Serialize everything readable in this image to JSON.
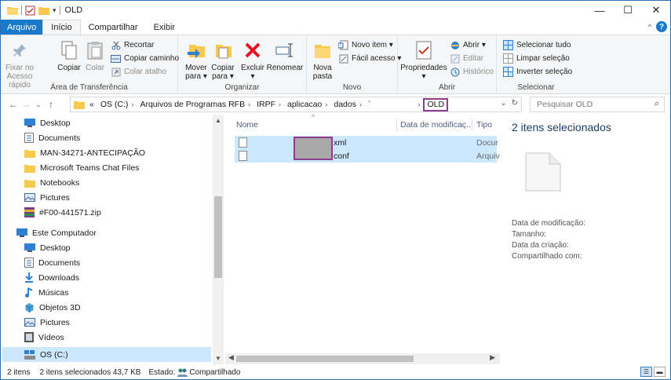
{
  "window": {
    "title": "OLD"
  },
  "tabs": {
    "file": "Arquivo",
    "home": "Início",
    "share": "Compartilhar",
    "view": "Exibir"
  },
  "ribbon": {
    "clipboard": {
      "label": "Área de Transferência",
      "pin": "Fixar no Acesso rápido",
      "copy": "Copiar",
      "paste": "Colar",
      "cut": "Recortar",
      "copy_path": "Copiar caminho",
      "paste_shortcut": "Colar atalho"
    },
    "organize": {
      "label": "Organizar",
      "move_to": "Mover para ▾",
      "copy_to": "Copiar para ▾",
      "delete": "Excluir ▾",
      "rename": "Renomear"
    },
    "new": {
      "label": "Novo",
      "new_folder": "Nova pasta",
      "new_item": "Novo item ▾",
      "easy_access": "Fácil acesso ▾"
    },
    "open": {
      "label": "Abrir",
      "properties": "Propriedades ▾",
      "open": "Abrir ▾",
      "edit": "Editar",
      "history": "Histórico"
    },
    "select": {
      "label": "Selecionar",
      "select_all": "Selecionar tudo",
      "select_none": "Limpar seleção",
      "invert": "Inverter seleção"
    }
  },
  "address": {
    "breadcrumbs": [
      "«",
      "OS (C:)",
      "Arquivos de Programas RFB",
      "IRPF",
      "aplicacao",
      "dados",
      "`",
      "OLD"
    ],
    "search_placeholder": "Pesquisar OLD"
  },
  "nav": {
    "items": [
      {
        "label": "Desktop",
        "icon": "desktop-icon"
      },
      {
        "label": "Documents",
        "icon": "documents-icon"
      },
      {
        "label": "MAN-34271-ANTECIPAÇÃO",
        "icon": "folder-icon"
      },
      {
        "label": "Microsoft Teams Chat Files",
        "icon": "folder-icon"
      },
      {
        "label": "Notebooks",
        "icon": "folder-icon"
      },
      {
        "label": "Pictures",
        "icon": "pictures-icon"
      },
      {
        "label": "#F00-441571.zip",
        "icon": "zip-icon"
      },
      {
        "label": "Este Computador",
        "icon": "computer-icon"
      },
      {
        "label": "Desktop",
        "icon": "desktop-icon"
      },
      {
        "label": "Documents",
        "icon": "documents-icon"
      },
      {
        "label": "Downloads",
        "icon": "downloads-icon"
      },
      {
        "label": "Músicas",
        "icon": "music-icon"
      },
      {
        "label": "Objetos 3D",
        "icon": "objects3d-icon"
      },
      {
        "label": "Pictures",
        "icon": "pictures-icon"
      },
      {
        "label": "Vídeos",
        "icon": "videos-icon"
      },
      {
        "label": "OS (C:)",
        "icon": "drive-icon"
      }
    ]
  },
  "files": {
    "columns": {
      "name": "Nome",
      "date": "Data de modificaç...",
      "type": "Tipo"
    },
    "rows": [
      {
        "name_suffix": "xml",
        "type": "Docur"
      },
      {
        "name_suffix": "conf",
        "type": "Arquiv"
      }
    ]
  },
  "details": {
    "title": "2 itens selecionados",
    "modified": "Data de modificação:",
    "size": "Tamanho:",
    "created": "Data da criação:",
    "shared": "Compartilhado com:"
  },
  "status": {
    "count": "2 itens",
    "selected": "2 itens selecionados  43,7 KB",
    "state_label": "Estado:",
    "state_value": "Compartilhado"
  },
  "colors": {
    "accent": "#1979ca",
    "selection": "#cce8ff",
    "highlight_border": "#8e3e8e"
  }
}
